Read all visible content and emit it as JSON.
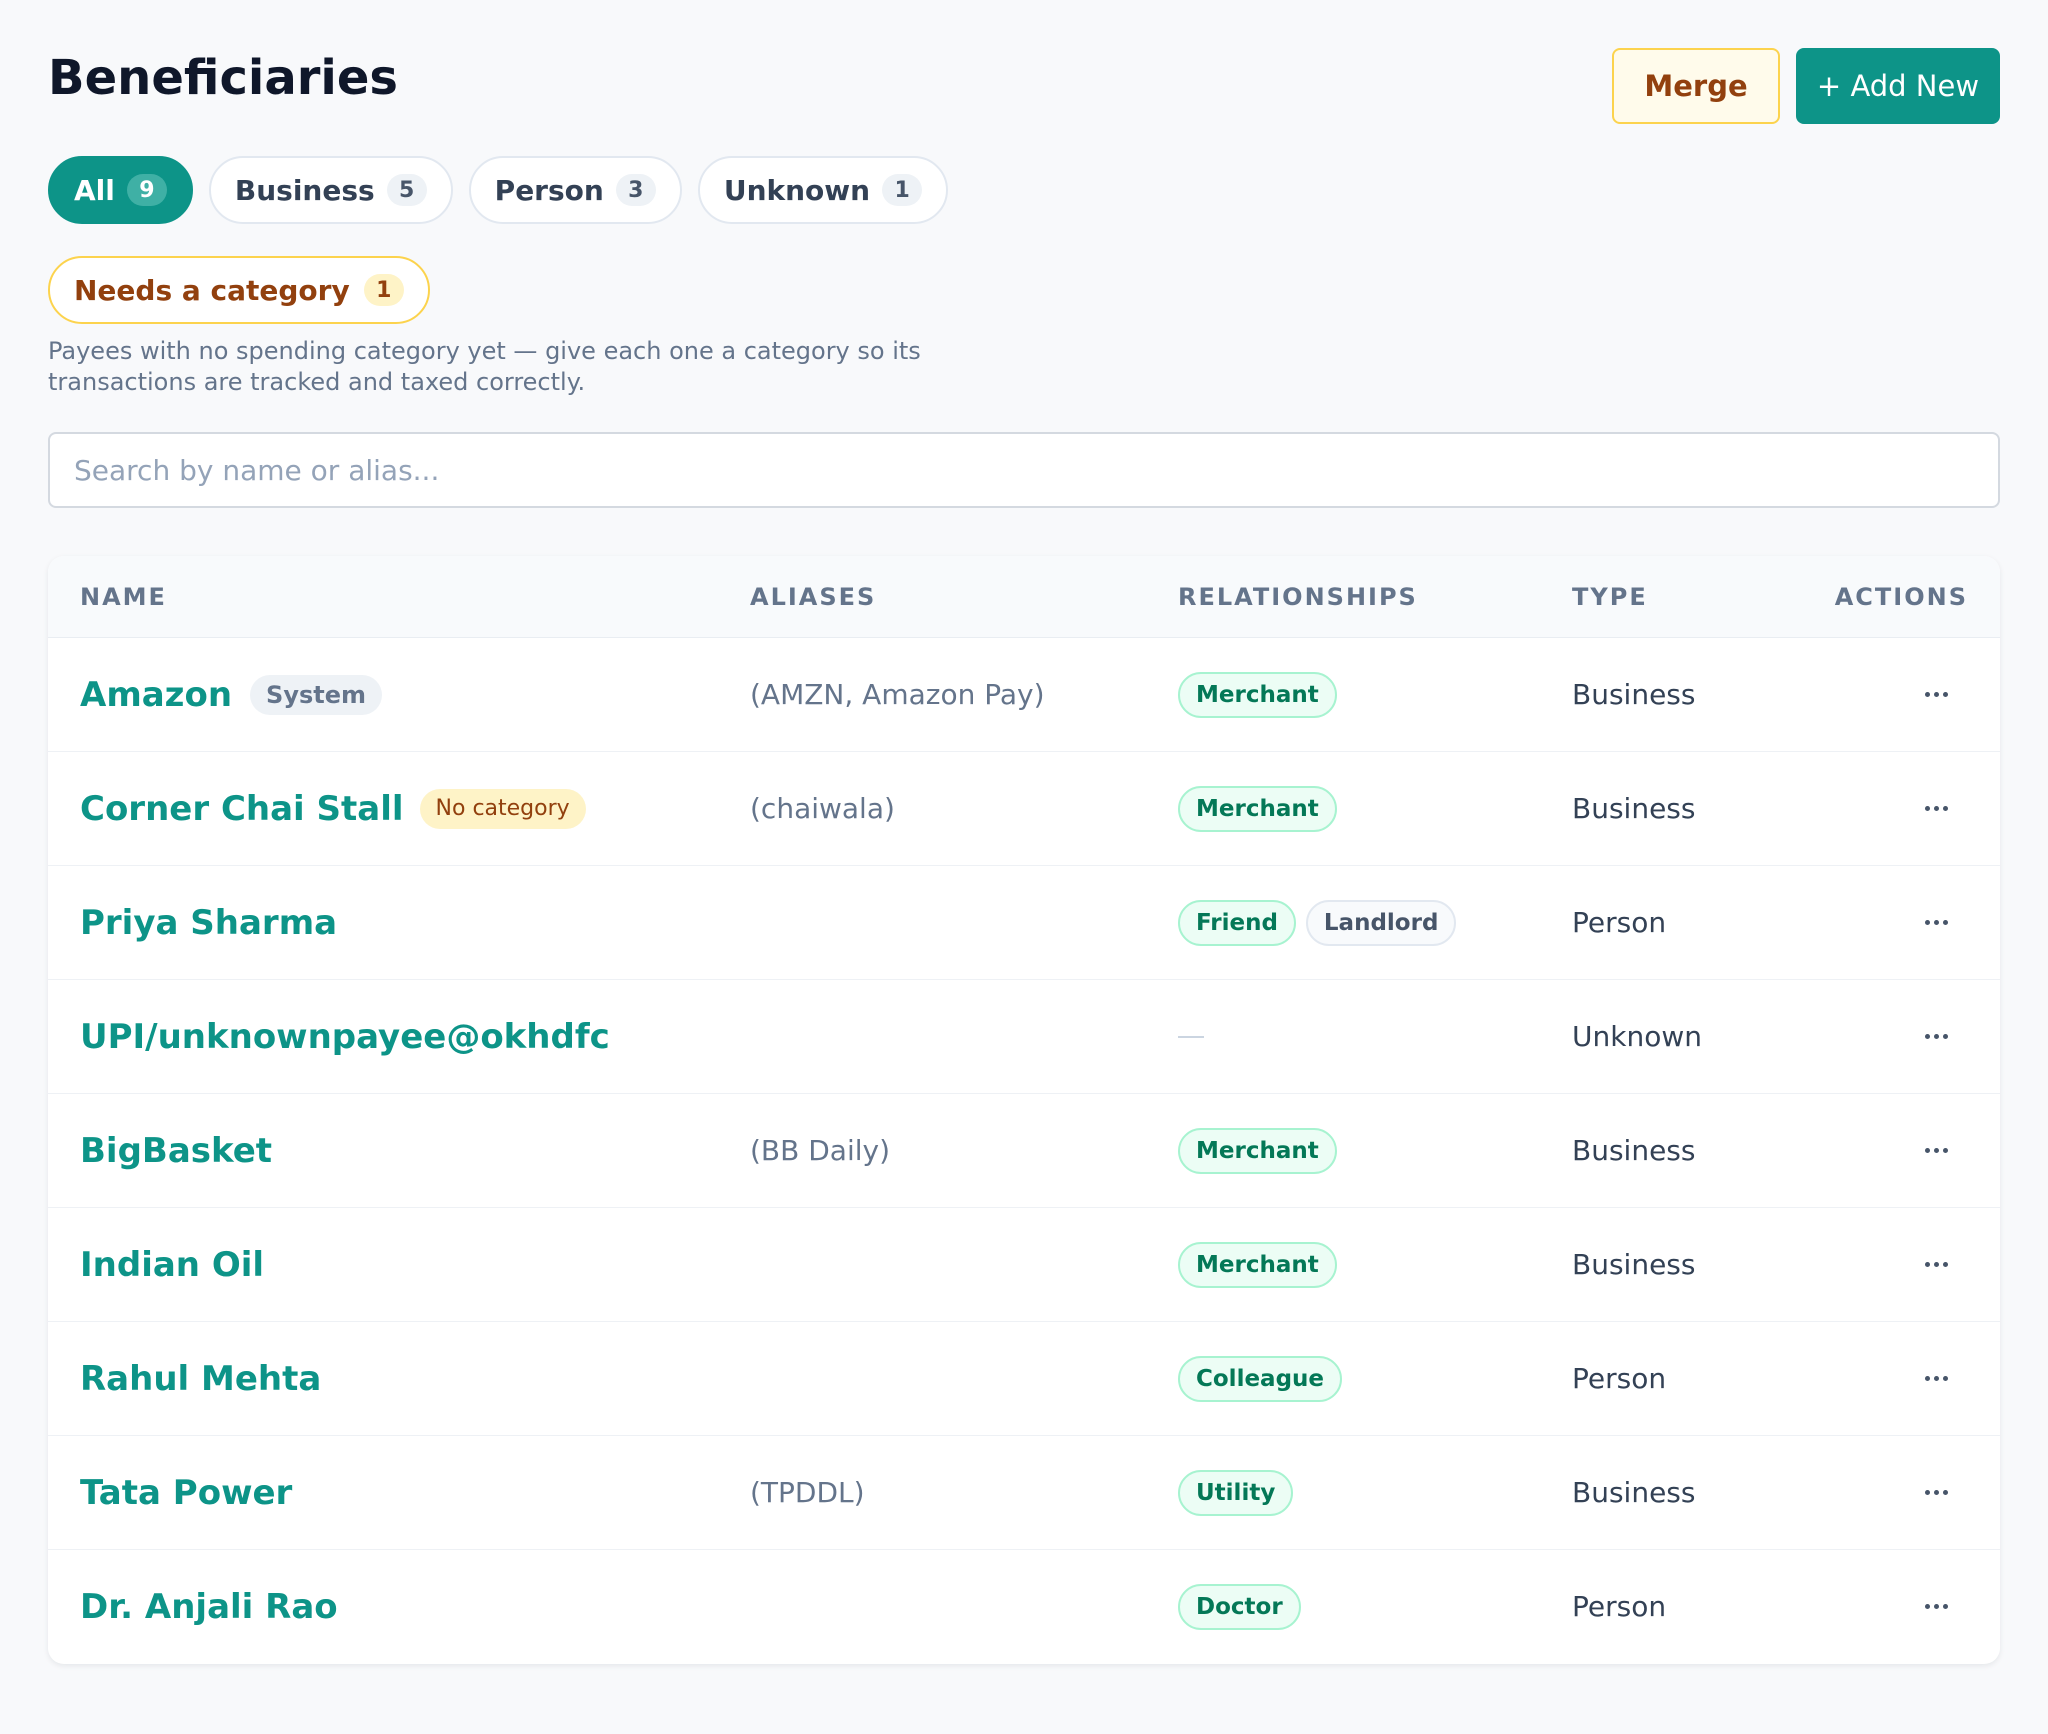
{
  "header": {
    "title": "Beneficiaries",
    "merge_label": "Merge",
    "add_label": "+ Add New"
  },
  "filters": [
    {
      "label": "All",
      "count": "9",
      "active": true
    },
    {
      "label": "Business",
      "count": "5",
      "active": false
    },
    {
      "label": "Person",
      "count": "3",
      "active": false
    },
    {
      "label": "Unknown",
      "count": "1",
      "active": false
    }
  ],
  "needs_category": {
    "label": "Needs a category",
    "count": "1",
    "helper": "Payees with no spending category yet — give each one a category so its transactions are tracked and taxed correctly."
  },
  "search": {
    "placeholder": "Search by name or alias...",
    "value": ""
  },
  "table": {
    "columns": {
      "name": "NAME",
      "aliases": "ALIASES",
      "relationships": "RELATIONSHIPS",
      "type": "TYPE",
      "actions": "ACTIONS"
    },
    "rows": [
      {
        "name": "Amazon",
        "badge": "System",
        "badge_kind": "system",
        "aliases": "(AMZN, Amazon Pay)",
        "relationships": [
          {
            "label": "Merchant",
            "style": "teal"
          }
        ],
        "type": "Business"
      },
      {
        "name": "Corner Chai Stall",
        "badge": "No category",
        "badge_kind": "nocat",
        "aliases": "(chaiwala)",
        "relationships": [
          {
            "label": "Merchant",
            "style": "teal"
          }
        ],
        "type": "Business"
      },
      {
        "name": "Priya Sharma",
        "badge": "",
        "badge_kind": "",
        "aliases": "",
        "relationships": [
          {
            "label": "Friend",
            "style": "teal"
          },
          {
            "label": "Landlord",
            "style": "gray"
          }
        ],
        "type": "Person"
      },
      {
        "name": "UPI/unknownpayee@okhdfc",
        "badge": "",
        "badge_kind": "",
        "aliases": "",
        "relationships": [],
        "type": "Unknown"
      },
      {
        "name": "BigBasket",
        "badge": "",
        "badge_kind": "",
        "aliases": "(BB Daily)",
        "relationships": [
          {
            "label": "Merchant",
            "style": "teal"
          }
        ],
        "type": "Business"
      },
      {
        "name": "Indian Oil",
        "badge": "",
        "badge_kind": "",
        "aliases": "",
        "relationships": [
          {
            "label": "Merchant",
            "style": "teal"
          }
        ],
        "type": "Business"
      },
      {
        "name": "Rahul Mehta",
        "badge": "",
        "badge_kind": "",
        "aliases": "",
        "relationships": [
          {
            "label": "Colleague",
            "style": "teal"
          }
        ],
        "type": "Person"
      },
      {
        "name": "Tata Power",
        "badge": "",
        "badge_kind": "",
        "aliases": "(TPDDL)",
        "relationships": [
          {
            "label": "Utility",
            "style": "teal"
          }
        ],
        "type": "Business"
      },
      {
        "name": "Dr. Anjali Rao",
        "badge": "",
        "badge_kind": "",
        "aliases": "",
        "relationships": [
          {
            "label": "Doctor",
            "style": "teal"
          }
        ],
        "type": "Person"
      }
    ]
  },
  "icons": {
    "row_action": "more-horizontal-icon"
  },
  "colors": {
    "accent": "#0d9488",
    "warning": "#92400e",
    "warning_bg": "#fef3c7"
  }
}
